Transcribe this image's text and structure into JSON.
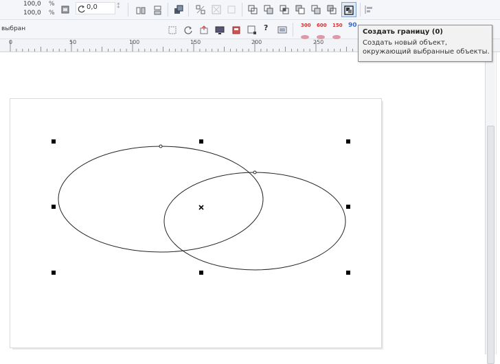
{
  "property_bar": {
    "scale_x": "100,0",
    "scale_y": "100,0",
    "scale_unit_x": "%",
    "scale_unit_y": "%",
    "rotation": "0,0"
  },
  "status": {
    "selection_label": "выбран"
  },
  "ruler": {
    "labels": [
      "0",
      "50",
      "100",
      "150",
      "200",
      "250"
    ]
  },
  "toolbar2": {
    "resolution_buttons": [
      "300",
      "600",
      "150",
      "90"
    ]
  },
  "tooltip": {
    "title": "Создать границу (0)",
    "description": "Создать новый объект, окружающий выбранные объекты."
  },
  "colors": {
    "toolbar_bg": "#f4f6f9",
    "accent": "#7ea1cc",
    "handle": "#000000"
  }
}
